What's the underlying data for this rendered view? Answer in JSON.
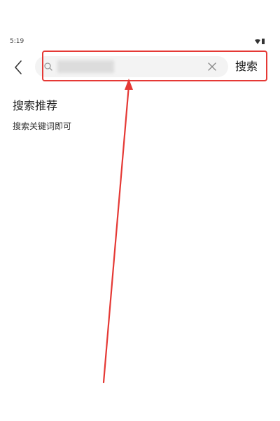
{
  "status_bar": {
    "time": "5:19",
    "icons": [
      "wifi-icon",
      "battery-icon"
    ]
  },
  "header": {
    "back_icon": "chevron-left-icon",
    "search": {
      "value": "",
      "value_obscured": true,
      "icon": "search-icon",
      "clear_icon": "close-icon"
    },
    "search_button_label": "搜索"
  },
  "recommendations": {
    "title": "搜索推荐",
    "hint": "搜索关键词即可"
  },
  "annotation": {
    "color": "#e53935"
  }
}
